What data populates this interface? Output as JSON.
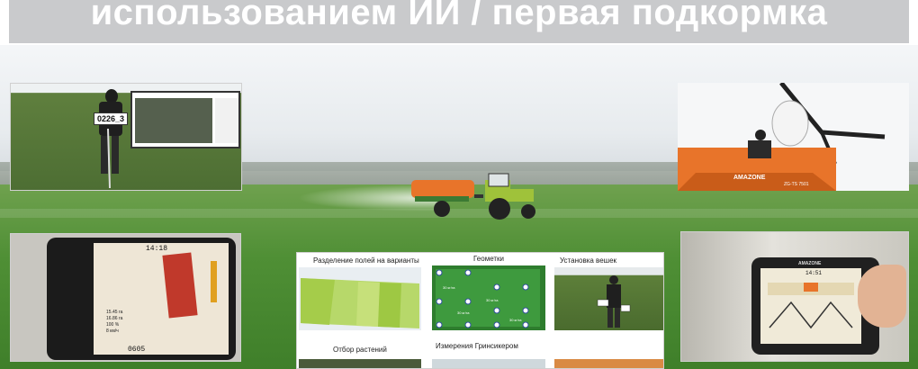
{
  "header": {
    "title": "использованием ИИ / первая подкормка"
  },
  "panel_field_marker": {
    "sample_tag": "0226_3"
  },
  "panel_spreader": {
    "brand": "AMAZONE",
    "model": "ZG-TS 7501"
  },
  "panel_terminal_left": {
    "clock": "14:18",
    "readouts": [
      "15.45 га",
      "16.86 га",
      "100 %",
      "8 км/ч"
    ],
    "counter": "0605"
  },
  "collage": {
    "tiles": [
      {
        "label": "Разделение полей на варианты"
      },
      {
        "label": "Геометки"
      },
      {
        "label": "Установка вешек"
      },
      {
        "label": "Отбор растений"
      },
      {
        "label": "Измерения Гринсикером"
      }
    ],
    "geo_labels": [
      "30 кг/га",
      "30 кг/га",
      "30 кг/га",
      "30 кг/га"
    ]
  },
  "panel_terminal_right": {
    "clock": "14:51",
    "brand": "AMAZONE"
  },
  "colors": {
    "header_bg": "#c9cacc",
    "spreader_orange": "#e8742a",
    "amazone_green": "#3c7a33",
    "field_green": "#4f8f35"
  }
}
